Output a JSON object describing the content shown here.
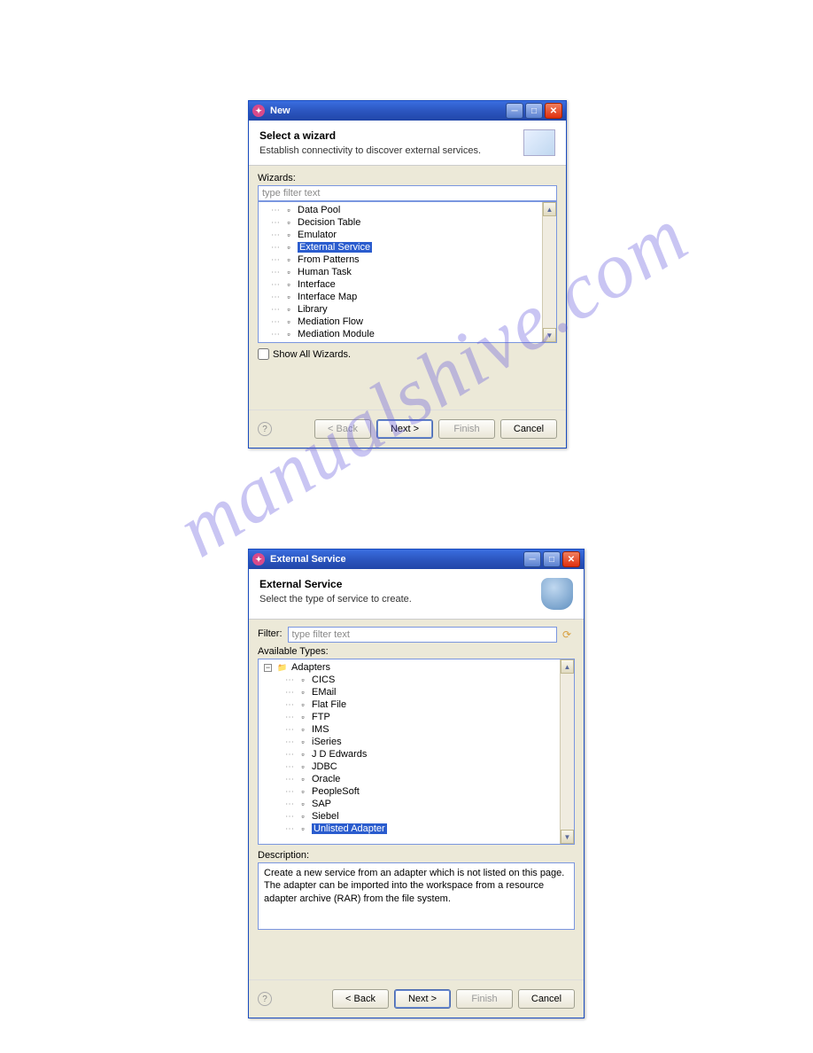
{
  "watermark": "manualshive.com",
  "dialog1": {
    "title": "New",
    "header_title": "Select a wizard",
    "header_subtitle": "Establish connectivity to discover external services.",
    "wizards_label": "Wizards:",
    "filter_placeholder": "type filter text",
    "tree_items": [
      {
        "label": "Data Pool",
        "selected": false
      },
      {
        "label": "Decision Table",
        "selected": false
      },
      {
        "label": "Emulator",
        "selected": false
      },
      {
        "label": "External Service",
        "selected": true
      },
      {
        "label": "From Patterns",
        "selected": false
      },
      {
        "label": "Human Task",
        "selected": false
      },
      {
        "label": "Interface",
        "selected": false
      },
      {
        "label": "Interface Map",
        "selected": false
      },
      {
        "label": "Library",
        "selected": false
      },
      {
        "label": "Mediation Flow",
        "selected": false
      },
      {
        "label": "Mediation Module",
        "selected": false
      }
    ],
    "show_all_label": "Show All Wizards.",
    "buttons": {
      "back": "< Back",
      "next": "Next >",
      "finish": "Finish",
      "cancel": "Cancel"
    }
  },
  "dialog2": {
    "title": "External Service",
    "header_title": "External Service",
    "header_subtitle": "Select the type of service to create.",
    "filter_label": "Filter:",
    "filter_placeholder": "type filter text",
    "available_label": "Available Types:",
    "root_label": "Adapters",
    "tree_items": [
      {
        "label": "CICS",
        "selected": false
      },
      {
        "label": "EMail",
        "selected": false
      },
      {
        "label": "Flat File",
        "selected": false
      },
      {
        "label": "FTP",
        "selected": false
      },
      {
        "label": "IMS",
        "selected": false
      },
      {
        "label": "iSeries",
        "selected": false
      },
      {
        "label": "J D Edwards",
        "selected": false
      },
      {
        "label": "JDBC",
        "selected": false
      },
      {
        "label": "Oracle",
        "selected": false
      },
      {
        "label": "PeopleSoft",
        "selected": false
      },
      {
        "label": "SAP",
        "selected": false
      },
      {
        "label": "Siebel",
        "selected": false
      },
      {
        "label": "Unlisted Adapter",
        "selected": true
      }
    ],
    "description_label": "Description:",
    "description_text": "Create a new service from an adapter which is not listed on this page.  The adapter can be imported into the workspace from a resource adapter archive (RAR) from the file system.",
    "buttons": {
      "back": "< Back",
      "next": "Next >",
      "finish": "Finish",
      "cancel": "Cancel"
    }
  }
}
